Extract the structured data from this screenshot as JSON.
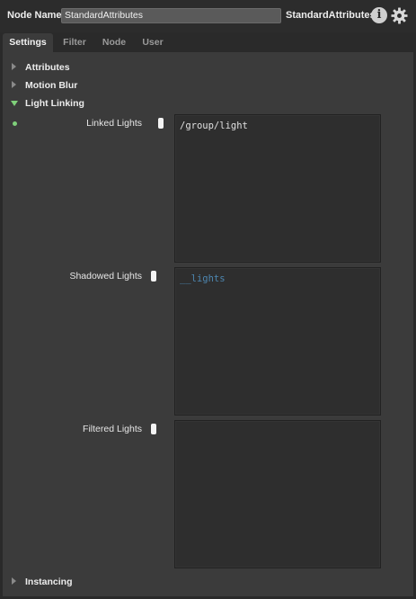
{
  "header": {
    "node_name_label": "Node Name",
    "node_name_value": "StandardAttributes",
    "node_type": "StandardAttributes",
    "info_icon": "info-icon",
    "gear_icon": "gear-icon"
  },
  "tabs": [
    {
      "label": "Settings",
      "active": true
    },
    {
      "label": "Filter",
      "active": false
    },
    {
      "label": "Node",
      "active": false
    },
    {
      "label": "User",
      "active": false
    }
  ],
  "groups": {
    "attributes": {
      "label": "Attributes",
      "expanded": false
    },
    "motion_blur": {
      "label": "Motion Blur",
      "expanded": false
    },
    "light_linking": {
      "label": "Light Linking",
      "expanded": true
    },
    "instancing": {
      "label": "Instancing",
      "expanded": false
    }
  },
  "light_linking": {
    "linked_lights": {
      "label": "Linked Lights",
      "value": "/group/light"
    },
    "shadowed_lights": {
      "label": "Shadowed Lights",
      "placeholder": "__lights"
    },
    "filtered_lights": {
      "label": "Filtered Lights",
      "value": ""
    }
  },
  "colors": {
    "accent_green": "#7fd07a",
    "placeholder_blue": "#4d86b0",
    "panel_bg": "#3b3b3b"
  }
}
